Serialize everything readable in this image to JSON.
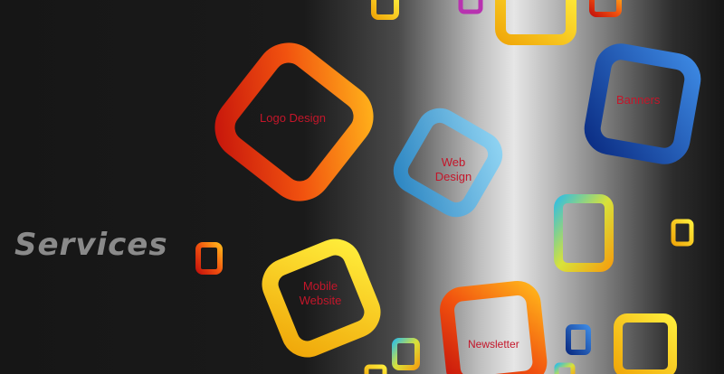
{
  "page": {
    "heading": "Services",
    "services": [
      {
        "label": "Logo Design"
      },
      {
        "label": "Web Design"
      },
      {
        "label": "Mobile Website"
      },
      {
        "label": "Newsletter"
      },
      {
        "label": "Banners"
      }
    ]
  },
  "colors": {
    "orange": "#f04a10",
    "blue": "#4aa9d8",
    "yellow": "#f2d20c",
    "navy": "#1b59b8",
    "label": "#c4162a",
    "heading": "#8a8a8a"
  }
}
